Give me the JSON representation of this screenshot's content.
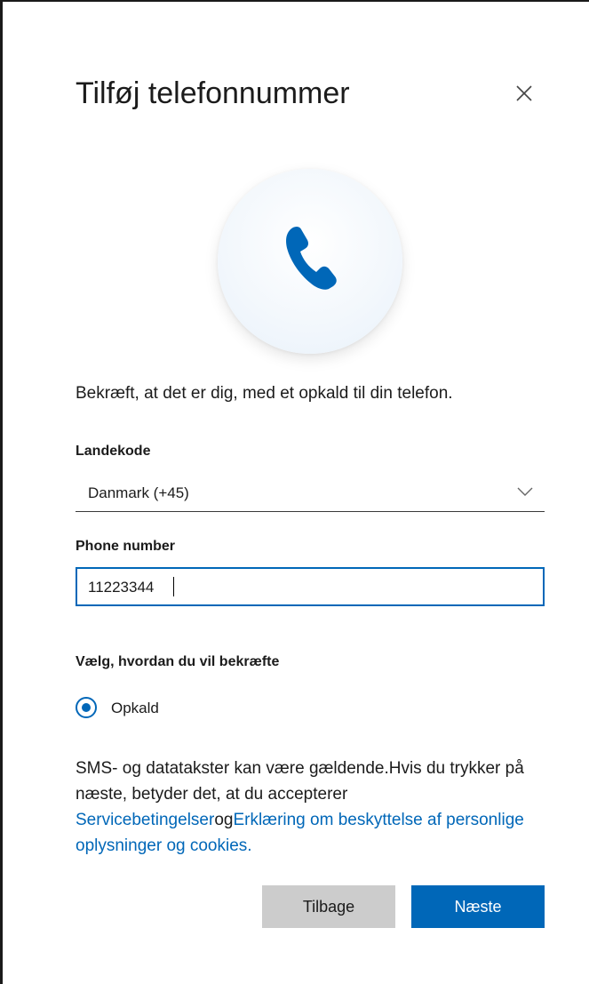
{
  "dialog": {
    "title": "Tilføj telefonnummer",
    "close_icon": "close-icon",
    "hero_icon": "phone-icon",
    "description": "Bekræft, at det er dig, med et opkald til din telefon."
  },
  "country": {
    "label": "Landekode",
    "selected": "Danmark (+45)",
    "icon": "chevron-down-icon"
  },
  "phone": {
    "label": "Phone number",
    "value": "11223344"
  },
  "method": {
    "label": "Vælg, hvordan du vil bekræfte",
    "options": [
      {
        "label": "Opkald",
        "selected": true
      }
    ]
  },
  "disclaimer": {
    "text": "SMS- og datatakster kan være gældende.Hvis du trykker på næste, betyder det, at du accepterer ",
    "terms_link": "Servicebetingelser",
    "connector": "og",
    "privacy_link": "Erklæring om beskyttelse af personlige oplysninger og cookies."
  },
  "buttons": {
    "back": "Tilbage",
    "next": "Næste"
  },
  "colors": {
    "accent": "#0067b8",
    "secondary_button": "#cccccc",
    "text": "#1b1b1b"
  }
}
